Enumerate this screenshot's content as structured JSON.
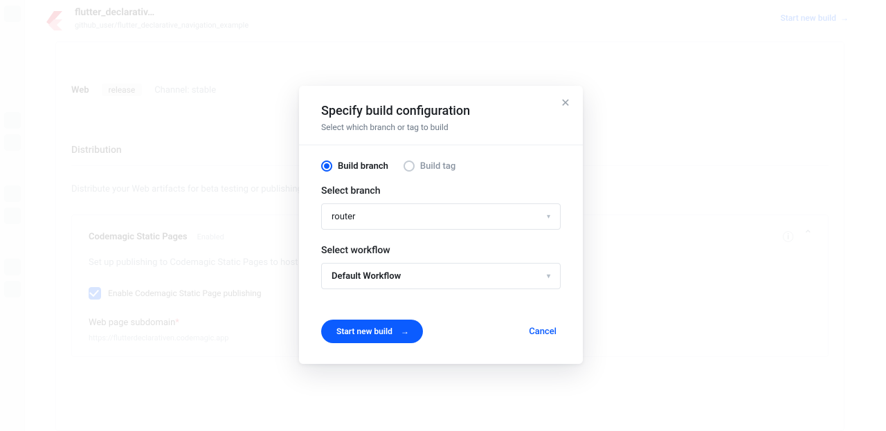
{
  "bg": {
    "app_title": "flutter_declarativ…",
    "app_subtitle": "github_user/flutter_declarative_navigation_example",
    "start_btn": "Start new build",
    "platform": "Web",
    "mode": "release",
    "channel": "Channel: stable",
    "section": "Distribution",
    "section_p": "Distribute your Web artifacts for beta testing or publishing via supported distribution channels.",
    "card_title": "Codemagic Static Pages",
    "card_badge": "Enabled",
    "card_p": "Set up publishing to Codemagic Static Pages to host your Web apps.",
    "checkbox_label": "Enable Codemagic Static Page publishing",
    "field_label": "Web page subdomain*",
    "footer_hint": "https://flutterdeclarativen.codemagic.app"
  },
  "modal": {
    "title": "Specify build configuration",
    "subtitle": "Select which branch or tag to build",
    "radio_branch": "Build branch",
    "radio_tag": "Build tag",
    "branch_label": "Select branch",
    "branch_value": "router",
    "workflow_label": "Select workflow",
    "workflow_value": "Default Workflow",
    "start": "Start new build",
    "cancel": "Cancel"
  }
}
